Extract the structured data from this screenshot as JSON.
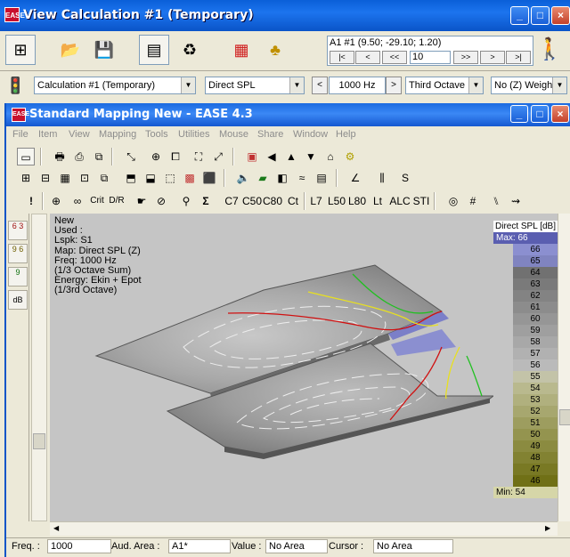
{
  "outer": {
    "title": "View Calculation #1 (Temporary)",
    "icon_text": "EASE"
  },
  "nav": {
    "coord": "A1 #1  (9.50; -29.10; 1.20)",
    "buttons": [
      "|<",
      "<",
      "<<",
      ">>",
      ">",
      ">|"
    ],
    "step": "10"
  },
  "selectors": {
    "calculation": "Calculation #1 (Temporary)",
    "quantity": "Direct SPL",
    "frequency": "1000 Hz",
    "bandwidth": "Third Octave",
    "weighting": "No (Z) Weigh"
  },
  "inner": {
    "title": "Standard Mapping New - EASE 4.3",
    "menu": [
      "File",
      "Item",
      "View",
      "Mapping",
      "Tools",
      "Utilities",
      "Mouse",
      "Share",
      "Window",
      "Help"
    ],
    "acoustic_toolbar": [
      "C7",
      "C50",
      "C80",
      "Ct",
      "L7",
      "L50",
      "L80",
      "Lt",
      "ALC",
      "STI"
    ],
    "left_tools": [
      "6 3",
      "9 6",
      "9",
      "dB"
    ]
  },
  "info": {
    "lines": [
      "New",
      "Used :",
      "Lspk: S1",
      "Map: Direct SPL (Z)",
      "Freq: 1000 Hz",
      "(1/3 Octave Sum)",
      "Energy: Ekin + Epot",
      "(1/3rd Octave)"
    ]
  },
  "legend": {
    "title": "Direct SPL [dB]",
    "max_label": "Max:  66",
    "min_label": "Min:  54",
    "levels": [
      "66",
      "65",
      "64",
      "63",
      "62",
      "61",
      "60",
      "59",
      "58",
      "57",
      "56",
      "55",
      "54",
      "53",
      "52",
      "51",
      "50",
      "49",
      "48",
      "47",
      "46"
    ],
    "colors": [
      "#8b8fd0",
      "#8084c0",
      "#717171",
      "#7a7a7a",
      "#838383",
      "#8c8c8c",
      "#969696",
      "#9f9f9f",
      "#a8a8a8",
      "#b1b1b1",
      "#bababa",
      "#c3c3a8",
      "#b9b98e",
      "#b0b07e",
      "#a7a76f",
      "#9d9d5f",
      "#94944f",
      "#8b8b40",
      "#828232",
      "#797924",
      "#707016"
    ]
  },
  "status": {
    "freq_label": "Freq. :",
    "freq_value": "1000",
    "area_label": "Aud. Area :",
    "area_value": "A1*",
    "value_label": "Value :",
    "value_value": "No Area",
    "cursor_label": "Cursor :",
    "cursor_value": "No Area"
  },
  "colors": {
    "titlebar": "#0a5fd8",
    "contour_red": "#d01010",
    "contour_yellow": "#e8e020",
    "contour_green": "#20c020",
    "highlight_area": "#7b7fc8"
  }
}
